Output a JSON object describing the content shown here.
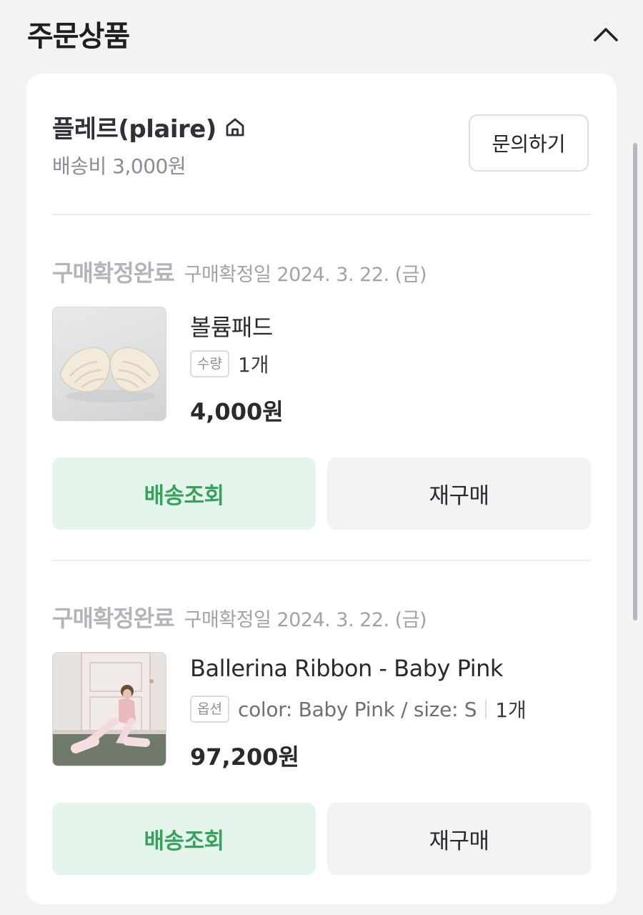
{
  "section": {
    "title": "주문상품"
  },
  "seller": {
    "name": "플레르(plaire)",
    "shipping_fee": "배송비 3,000원",
    "inquiry_label": "문의하기"
  },
  "orders": [
    {
      "status": "구매확정완료",
      "date": "구매확정일 2024. 3. 22. (금)",
      "product_name": "볼륨패드",
      "option_badge": "수량",
      "option_text": "",
      "quantity": "1개",
      "price": "4,000원",
      "track_label": "배송조회",
      "rebuy_label": "재구매"
    },
    {
      "status": "구매확정완료",
      "date": "구매확정일 2024. 3. 22. (금)",
      "product_name": "Ballerina Ribbon - Baby Pink",
      "option_badge": "옵션",
      "option_text": "color: Baby Pink / size: S",
      "quantity": "1개",
      "price": "97,200원",
      "track_label": "배송조회",
      "rebuy_label": "재구매"
    }
  ],
  "icons": {
    "collapse": "chevron-up-icon",
    "store": "home-icon"
  },
  "colors": {
    "background": "#f2f3f5",
    "card": "#ffffff",
    "accent_green": "#3aa05f",
    "accent_green_bg": "#e4f6ec"
  }
}
